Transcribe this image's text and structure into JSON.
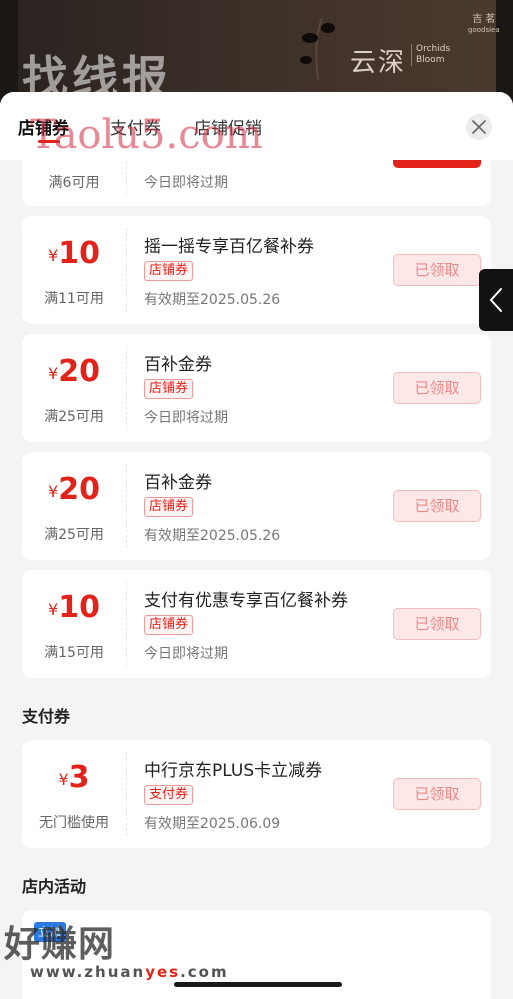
{
  "banner": {
    "title_cn": "云深",
    "title_en_line1": "Orchids",
    "title_en_line2": "Bloom",
    "logo_line1": "吉 茗",
    "logo_line2": "goodsiea"
  },
  "watermarks": {
    "top": "找线报",
    "middle": "Taolu5.com",
    "bottom": "好赚网",
    "bottom_url_a": "www.zhuan",
    "bottom_url_b": "yes",
    "bottom_url_c": ".com"
  },
  "tabs": [
    {
      "label": "店铺券"
    },
    {
      "label": "支付券"
    },
    {
      "label": "店铺促销"
    }
  ],
  "store_coupons": [
    {
      "yen": "",
      "amount": "",
      "condition": "满6可用",
      "title": "",
      "tag": "",
      "sub": "今日即将过期",
      "button": ""
    },
    {
      "yen": "¥",
      "amount": "10",
      "condition": "满11可用",
      "title": "摇一摇专享百亿餐补券",
      "tag": "店铺券",
      "sub": "有效期至2025.05.26",
      "button": "已领取"
    },
    {
      "yen": "¥",
      "amount": "20",
      "condition": "满25可用",
      "title": "百补金券",
      "tag": "店铺券",
      "sub": "今日即将过期",
      "button": "已领取"
    },
    {
      "yen": "¥",
      "amount": "20",
      "condition": "满25可用",
      "title": "百补金券",
      "tag": "店铺券",
      "sub": "有效期至2025.05.26",
      "button": "已领取"
    },
    {
      "yen": "¥",
      "amount": "10",
      "condition": "满15可用",
      "title": "支付有优惠专享百亿餐补券",
      "tag": "店铺券",
      "sub": "今日即将过期",
      "button": "已领取"
    }
  ],
  "pay_section_title": "支付券",
  "pay_coupons": [
    {
      "yen": "¥",
      "amount": "3",
      "condition": "无门槛使用",
      "title": "中行京东PLUS卡立减券",
      "tag": "支付券",
      "sub": "有效期至2025.06.09",
      "button": "已领取"
    }
  ],
  "activity_section_title": "店内活动",
  "activity_badge": "立减",
  "colors": {
    "accent": "#e2231a",
    "button_bg": "#fde7e7"
  }
}
